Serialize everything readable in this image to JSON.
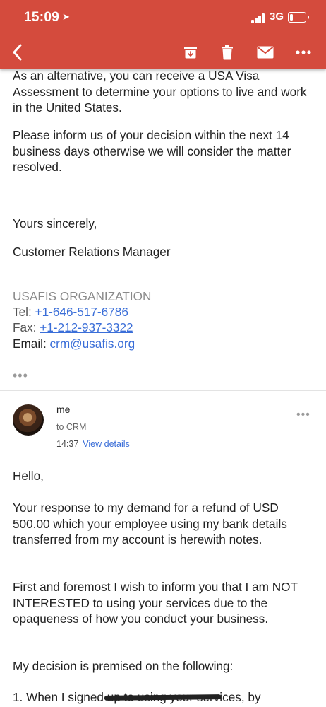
{
  "status_bar": {
    "time": "15:09",
    "location_glyph": "➤",
    "network": "3G",
    "battery_percent": 20
  },
  "toolbar": {
    "icons": [
      "back-arrow-icon",
      "archive-icon",
      "trash-icon",
      "mail-icon",
      "more-icon"
    ]
  },
  "prev_email": {
    "para1": "As an alternative, you can receive a USA Visa Assessment to determine your options to live and work in the United States.",
    "para2": "Please inform us of your decision within the next 14 business days otherwise we will consider the matter resolved.",
    "closing": "Yours sincerely,",
    "signer": "Customer Relations Manager",
    "org": "USAFIS ORGANIZATION",
    "tel_label": "Tel: ",
    "tel": "+1-646-517-6786",
    "fax_label": "Fax: ",
    "fax": "+1-212-937-3322",
    "email_label": "Email: ",
    "email": "crm@usafis.org",
    "collapsed_indicator": "•••"
  },
  "reply": {
    "sender": "me",
    "to": "to CRM",
    "time": "14:37",
    "view_details": "View details",
    "more": "•••",
    "greeting": "Hello,",
    "para1": "Your response to my demand for a refund of USD 500.00 which your employee using my bank details transferred from my account is herewith notes.",
    "para2": "First and foremost I wish to inform you that I am NOT INTERESTED to using your services due to the opaqueness of how you conduct your business.",
    "para3": "My decision is premised on the following:",
    "para4": "1. When I signed up to using your services, by"
  },
  "colors": {
    "appbar": "#d44b3d",
    "link": "#3a6ed8"
  }
}
